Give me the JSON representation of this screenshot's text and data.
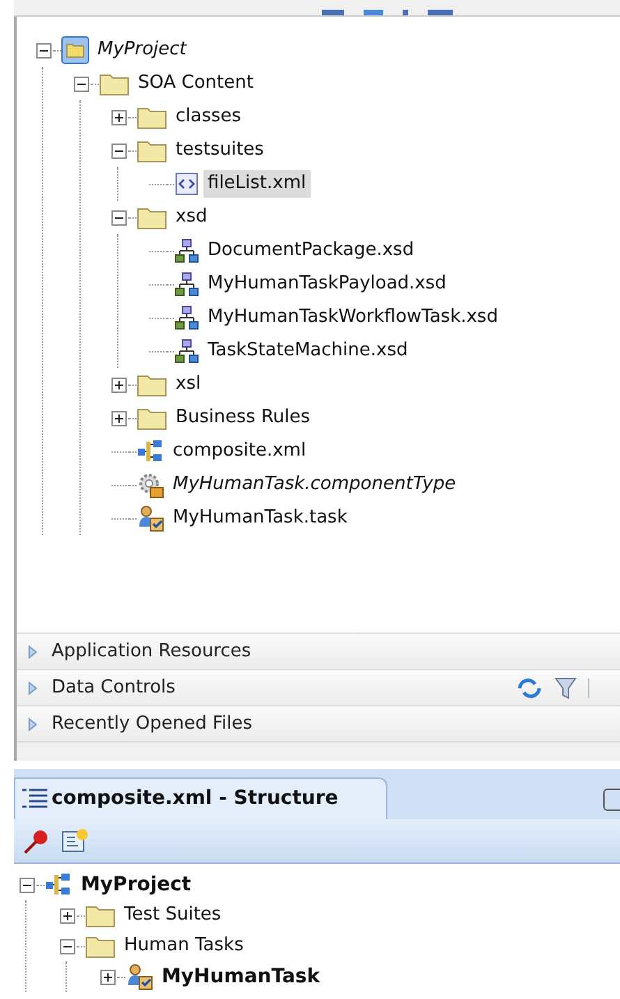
{
  "projects_tree": [
    {
      "label": "MyProject",
      "kind": "project",
      "italic": true,
      "bold": false,
      "selected": false,
      "expanded": true,
      "children": [
        {
          "label": "SOA Content",
          "kind": "folder",
          "italic": false,
          "bold": false,
          "selected": false,
          "expanded": true,
          "children": [
            {
              "label": "classes",
              "kind": "folder",
              "italic": false,
              "bold": false,
              "selected": false,
              "expanded": false
            },
            {
              "label": "testsuites",
              "kind": "folder",
              "italic": false,
              "bold": false,
              "selected": false,
              "expanded": true,
              "children": [
                {
                  "label": "fileList.xml",
                  "kind": "xml",
                  "italic": false,
                  "bold": false,
                  "selected": true
                }
              ]
            },
            {
              "label": "xsd",
              "kind": "folder",
              "italic": false,
              "bold": false,
              "selected": false,
              "expanded": true,
              "children": [
                {
                  "label": "DocumentPackage.xsd",
                  "kind": "schema",
                  "italic": false,
                  "bold": false,
                  "selected": false
                },
                {
                  "label": "MyHumanTaskPayload.xsd",
                  "kind": "schema",
                  "italic": false,
                  "bold": false,
                  "selected": false
                },
                {
                  "label": "MyHumanTaskWorkflowTask.xsd",
                  "kind": "schema",
                  "italic": false,
                  "bold": false,
                  "selected": false
                },
                {
                  "label": "TaskStateMachine.xsd",
                  "kind": "schema",
                  "italic": false,
                  "bold": false,
                  "selected": false
                }
              ]
            },
            {
              "label": "xsl",
              "kind": "folder",
              "italic": false,
              "bold": false,
              "selected": false,
              "expanded": false
            },
            {
              "label": "Business Rules",
              "kind": "folder",
              "italic": false,
              "bold": false,
              "selected": false,
              "expanded": false
            },
            {
              "label": "composite.xml",
              "kind": "composite",
              "italic": false,
              "bold": false,
              "selected": false
            },
            {
              "label": "MyHumanTask.componentType",
              "kind": "component",
              "italic": true,
              "bold": false,
              "selected": false
            },
            {
              "label": "MyHumanTask.task",
              "kind": "task",
              "italic": false,
              "bold": false,
              "selected": false
            }
          ]
        }
      ]
    }
  ],
  "accordion": [
    {
      "label": "Application Resources",
      "expanded": false,
      "tools": false
    },
    {
      "label": "Data Controls",
      "expanded": false,
      "tools": true
    },
    {
      "label": "Recently Opened Files",
      "expanded": false,
      "tools": false
    }
  ],
  "structure_tab": {
    "title": "composite.xml - Structure"
  },
  "structure_tree": [
    {
      "label": "MyProject",
      "kind": "composite",
      "italic": false,
      "bold": true,
      "selected": false,
      "expanded": true,
      "children": [
        {
          "label": "Test Suites",
          "kind": "folder",
          "italic": false,
          "bold": false,
          "selected": false,
          "expanded": false
        },
        {
          "label": "Human Tasks",
          "kind": "folder",
          "italic": false,
          "bold": false,
          "selected": false,
          "expanded": true,
          "children": [
            {
              "label": "MyHumanTask",
              "kind": "task",
              "italic": false,
              "bold": true,
              "selected": false,
              "expanded": false
            }
          ]
        }
      ]
    }
  ]
}
